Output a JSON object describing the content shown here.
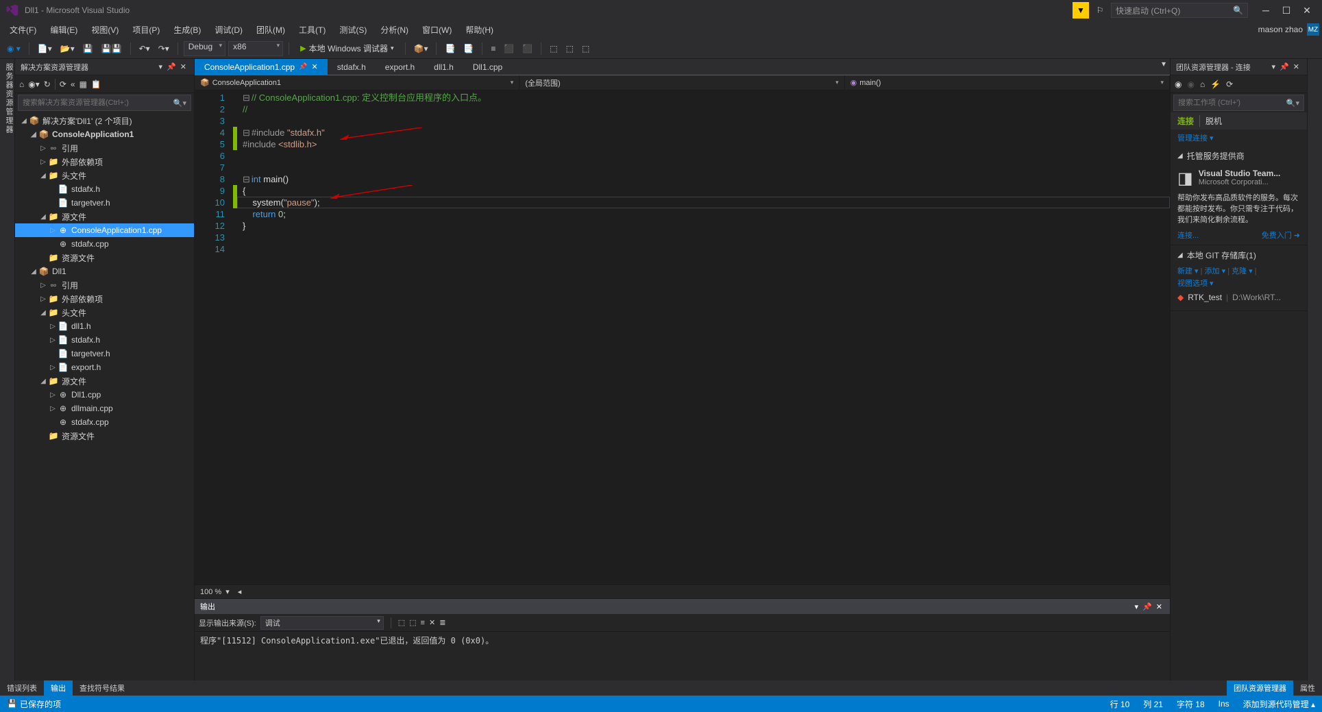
{
  "titlebar": {
    "title": "Dll1 - Microsoft Visual Studio",
    "quick_launch_placeholder": "快速启动 (Ctrl+Q)"
  },
  "menubar": {
    "items": [
      "文件(F)",
      "编辑(E)",
      "视图(V)",
      "项目(P)",
      "生成(B)",
      "调试(D)",
      "团队(M)",
      "工具(T)",
      "测试(S)",
      "分析(N)",
      "窗口(W)",
      "帮助(H)"
    ],
    "user": "mason zhao",
    "avatar": "MZ"
  },
  "toolbar": {
    "config": "Debug",
    "platform": "x86",
    "debug_target": "本地 Windows 调试器"
  },
  "solution_explorer": {
    "title": "解决方案资源管理器",
    "search_placeholder": "搜索解决方案资源管理器(Ctrl+;)",
    "root": "解决方案'Dll1' (2 个项目)",
    "project1": "ConsoleApplication1",
    "project2": "Dll1",
    "ref": "引用",
    "ext_deps": "外部依赖项",
    "headers": "头文件",
    "sources": "源文件",
    "resources": "资源文件",
    "files_p1_h": [
      "stdafx.h",
      "targetver.h"
    ],
    "files_p1_cpp": [
      "ConsoleApplication1.cpp",
      "stdafx.cpp"
    ],
    "files_p2_h": [
      "dll1.h",
      "stdafx.h",
      "targetver.h",
      "export.h"
    ],
    "files_p2_cpp": [
      "Dll1.cpp",
      "dllmain.cpp",
      "stdafx.cpp"
    ]
  },
  "editor": {
    "tabs": [
      "ConsoleApplication1.cpp",
      "stdafx.h",
      "export.h",
      "dll1.h",
      "Dll1.cpp"
    ],
    "nav_left": "ConsoleApplication1",
    "nav_mid": "(全局范围)",
    "nav_right": "main()",
    "zoom": "100 %",
    "lines": [
      {
        "n": 1,
        "t": "comment",
        "pre": "⊟",
        "txt": "// ConsoleApplication1.cpp: 定义控制台应用程序的入口点。"
      },
      {
        "n": 2,
        "t": "comment",
        "pre": "",
        "txt": "//"
      },
      {
        "n": 3,
        "t": "",
        "pre": "",
        "txt": ""
      },
      {
        "n": 4,
        "t": "inc",
        "pre": "⊟",
        "txt": "#include \"stdafx.h\"",
        "mod": true
      },
      {
        "n": 5,
        "t": "inc2",
        "pre": "",
        "txt": "#include <stdlib.h>",
        "mod": true
      },
      {
        "n": 6,
        "t": "",
        "pre": "",
        "txt": ""
      },
      {
        "n": 7,
        "t": "",
        "pre": "",
        "txt": ""
      },
      {
        "n": 8,
        "t": "func",
        "pre": "⊟",
        "txt": "int main()"
      },
      {
        "n": 9,
        "t": "",
        "pre": "",
        "txt": "{",
        "mod": true
      },
      {
        "n": 10,
        "t": "sys",
        "pre": "",
        "txt": "    system(\"pause\");",
        "mod": true,
        "cursor": true
      },
      {
        "n": 11,
        "t": "ret",
        "pre": "",
        "txt": "    return 0;"
      },
      {
        "n": 12,
        "t": "",
        "pre": "",
        "txt": "}"
      },
      {
        "n": 13,
        "t": "",
        "pre": "",
        "txt": ""
      },
      {
        "n": 14,
        "t": "",
        "pre": "",
        "txt": ""
      }
    ]
  },
  "team_explorer": {
    "title": "团队资源管理器 - 连接",
    "search_placeholder": "搜索工作项 (Ctrl+')",
    "connect": "连接",
    "offline": "脱机",
    "manage_link": "管理连接 ▾",
    "hosted_title": "托管服务提供商",
    "vsts_title": "Visual Studio Team...",
    "vsts_sub": "Microsoft Corporati...",
    "vsts_desc": "帮助你发布高品质软件的服务。每次都能按时发布。你只需专注于代码，我们来简化剩余流程。",
    "connect_link": "连接...",
    "free_start": "免费入门",
    "local_git_title": "本地 GIT 存储库(1)",
    "git_new": "新建 ▾",
    "git_add": "添加 ▾",
    "git_clone": "克隆 ▾",
    "git_view": "视图选项 ▾",
    "repo_name": "RTK_test",
    "repo_path": "D:\\Work\\RT..."
  },
  "output": {
    "title": "输出",
    "source_label": "显示输出来源(S):",
    "source_value": "调试",
    "text": "程序\"[11512] ConsoleApplication1.exe\"已退出，返回值为 0 (0x0)。"
  },
  "bottom_tabs": {
    "error_list": "错误列表",
    "output": "输出",
    "find_results": "查找符号结果",
    "team_explorer": "团队资源管理器",
    "properties": "属性"
  },
  "statusbar": {
    "saved": "已保存的项",
    "line": "行 10",
    "col": "列 21",
    "ch": "字符 18",
    "ins": "Ins",
    "add_src": "添加到源代码管理 ▴"
  },
  "vtab_left": "服务器资源管理器"
}
